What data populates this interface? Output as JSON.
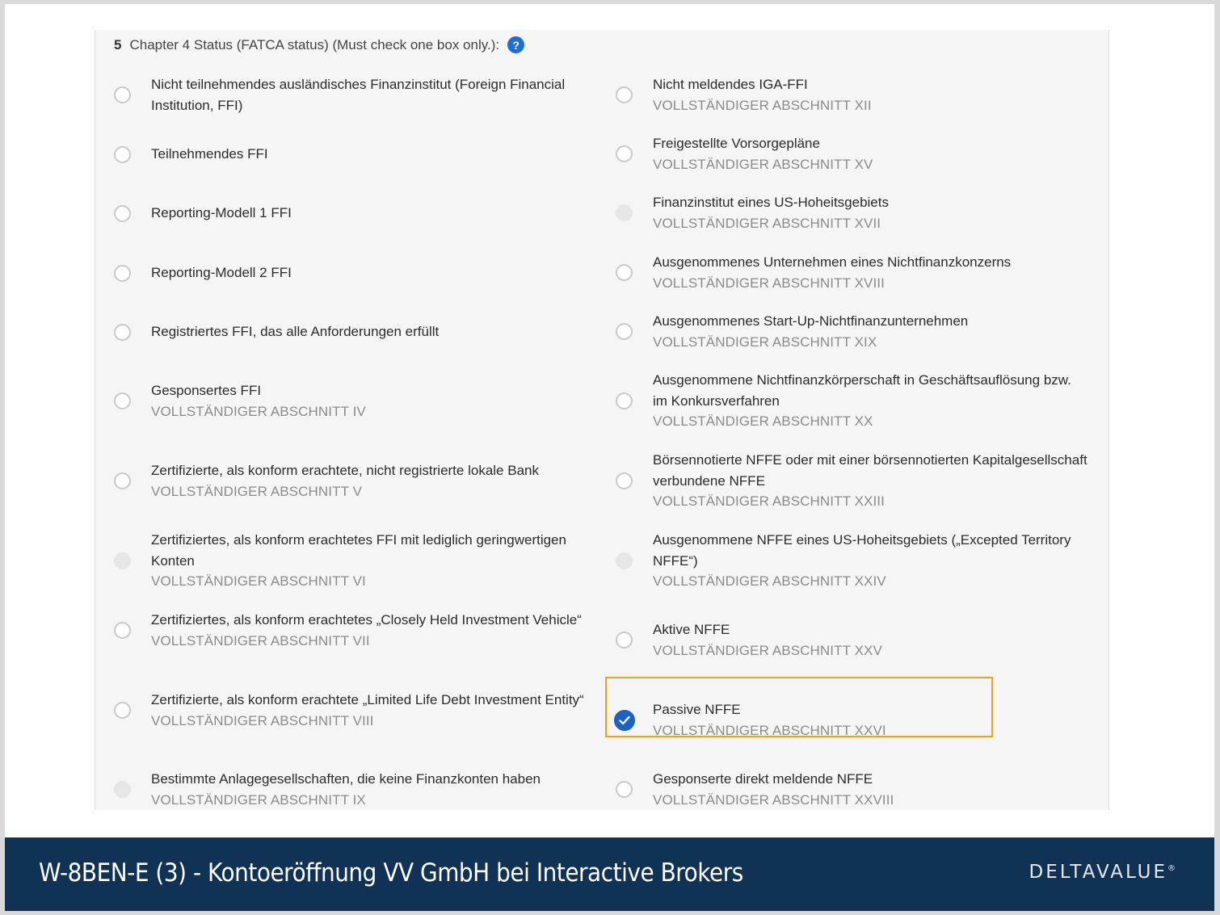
{
  "section": {
    "number": "5",
    "label": "Chapter 4 Status (FATCA status) (Must check one box only.):",
    "help_icon": "?"
  },
  "left_options": [
    {
      "label": "Nicht teilnehmendes ausländisches Finanzinstitut (Foreign Financial Institution, FFI)",
      "sub": "",
      "state": "unchecked"
    },
    {
      "label": "Teilnehmendes FFI",
      "sub": "",
      "state": "unchecked"
    },
    {
      "label": "Reporting-Modell 1 FFI",
      "sub": "",
      "state": "unchecked"
    },
    {
      "label": "Reporting-Modell 2 FFI",
      "sub": "",
      "state": "unchecked"
    },
    {
      "label": "Registriertes FFI, das alle Anforderungen erfüllt",
      "sub": "",
      "state": "unchecked"
    },
    {
      "label": "Gesponsertes FFI",
      "sub": "VOLLSTÄNDIGER ABSCHNITT IV",
      "state": "unchecked"
    },
    {
      "label": "Zertifizierte, als konform erachtete, nicht registrierte lokale Bank",
      "sub": "VOLLSTÄNDIGER ABSCHNITT V",
      "state": "unchecked"
    },
    {
      "label": "Zertifiziertes, als konform erachtetes FFI mit lediglich geringwertigen Konten",
      "sub": "VOLLSTÄNDIGER ABSCHNITT VI",
      "state": "disabled"
    },
    {
      "label": "Zertifiziertes, als konform erachtetes „Closely Held Investment Vehicle“",
      "sub": "VOLLSTÄNDIGER ABSCHNITT VII",
      "state": "unchecked"
    },
    {
      "label": "Zertifizierte, als konform erachtete „Limited Life Debt Investment Entity“",
      "sub": "VOLLSTÄNDIGER ABSCHNITT VIII",
      "state": "unchecked"
    },
    {
      "label": "Bestimmte Anlagegesellschaften, die keine Finanzkonten haben",
      "sub": "VOLLSTÄNDIGER ABSCHNITT IX",
      "state": "disabled"
    }
  ],
  "right_options": [
    {
      "label": "Nicht meldendes IGA-FFI",
      "sub": "VOLLSTÄNDIGER ABSCHNITT XII",
      "state": "unchecked"
    },
    {
      "label": "Freigestellte Vorsorgepläne",
      "sub": "VOLLSTÄNDIGER ABSCHNITT XV",
      "state": "unchecked"
    },
    {
      "label": "Finanzinstitut eines US-Hoheitsgebiets",
      "sub": "VOLLSTÄNDIGER ABSCHNITT XVII",
      "state": "disabled"
    },
    {
      "label": "Ausgenommenes Unternehmen eines Nichtfinanzkonzerns",
      "sub": "VOLLSTÄNDIGER ABSCHNITT XVIII",
      "state": "unchecked"
    },
    {
      "label": "Ausgenommenes Start-Up-Nichtfinanzunternehmen",
      "sub": "VOLLSTÄNDIGER ABSCHNITT XIX",
      "state": "unchecked"
    },
    {
      "label": "Ausgenommene Nichtfinanzkörperschaft in Geschäftsauflösung bzw. im Konkursverfahren",
      "sub": "VOLLSTÄNDIGER ABSCHNITT XX",
      "state": "unchecked"
    },
    {
      "label": "Börsennotierte NFFE oder mit einer börsennotierten Kapitalgesellschaft verbundene NFFE",
      "sub": "VOLLSTÄNDIGER ABSCHNITT XXIII",
      "state": "unchecked"
    },
    {
      "label": "Ausgenommene NFFE eines US-Hoheitsgebiets („Excepted Territory NFFE“)",
      "sub": "VOLLSTÄNDIGER ABSCHNITT XXIV",
      "state": "disabled"
    },
    {
      "label": "Aktive NFFE",
      "sub": "VOLLSTÄNDIGER ABSCHNITT XXV",
      "state": "unchecked"
    },
    {
      "label": "Passive NFFE",
      "sub": "VOLLSTÄNDIGER ABSCHNITT XXVI",
      "state": "checked"
    },
    {
      "label": "Gesponserte direkt meldende NFFE",
      "sub": "VOLLSTÄNDIGER ABSCHNITT XXVIII",
      "state": "unchecked"
    }
  ],
  "footer": {
    "title": "W-8BEN-E (3) - Kontoeröffnung VV GmbH bei Interactive Brokers",
    "brand": "DELTAVALUE",
    "brand_mark": "®"
  },
  "colors": {
    "footer_bg": "#0f3255",
    "highlight_border": "#f0a21c",
    "checked_radio": "#1a63c2",
    "subtext": "#8b8b8b"
  }
}
